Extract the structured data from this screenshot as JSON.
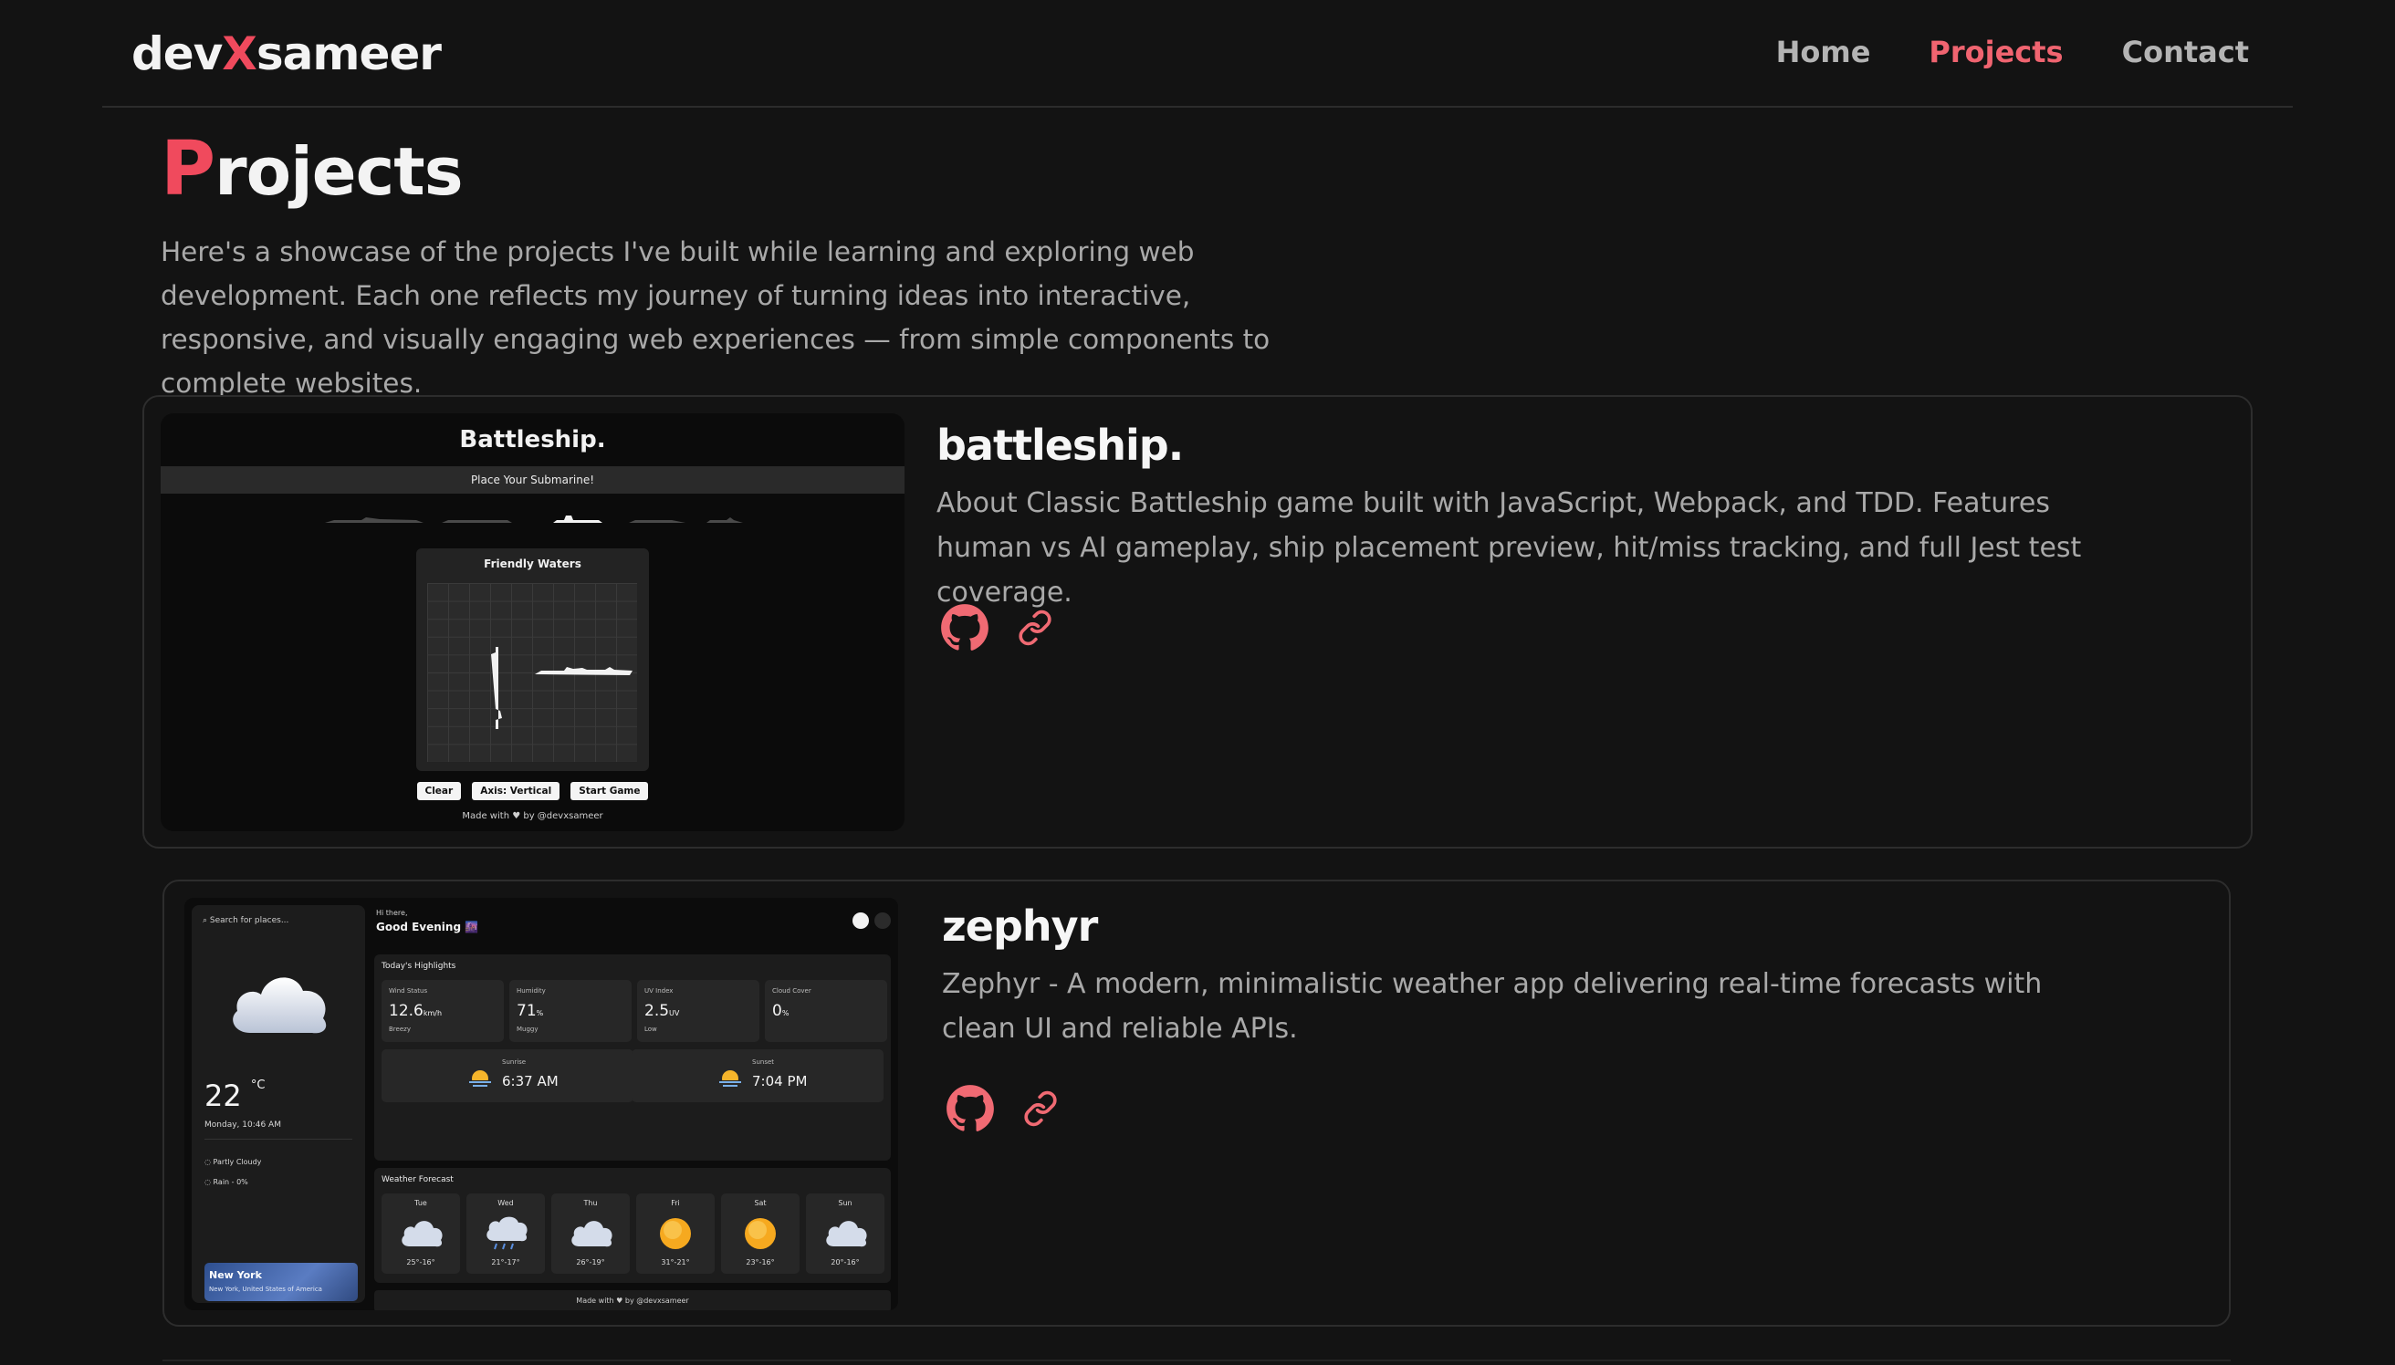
{
  "header": {
    "logo_prefix": "dev",
    "logo_x": "X",
    "logo_suffix": "sameer",
    "nav": [
      {
        "label": "Home"
      },
      {
        "label": "Projects"
      },
      {
        "label": "Contact"
      }
    ]
  },
  "intro": {
    "title_first": "P",
    "title_rest": "rojects",
    "text": "Here's a showcase of the projects I've built while learning and exploring web development. Each one reflects my journey of turning ideas into interactive, responsive, and visually engaging web experiences — from simple components to complete websites."
  },
  "projects": [
    {
      "title": "battleship.",
      "description": "About Classic Battleship game built with JavaScript, Webpack, and TDD. Features human vs AI gameplay, ship placement preview, hit/miss tracking, and full Jest test coverage.",
      "preview": {
        "title": "Battleship.",
        "banner": "Place Your Submarine!",
        "board_title": "Friendly Waters",
        "buttons": [
          "Clear",
          "Axis: Vertical",
          "Start Game"
        ],
        "footer": "Made with ♥ by @devxsameer"
      }
    },
    {
      "title": "zephyr",
      "description": "Zephyr - A modern, minimalistic weather app delivering real-time forecasts with clean UI and reliable APIs.",
      "preview": {
        "search_placeholder": "Search for places...",
        "temperature": "22",
        "unit": "°C",
        "date": "Monday, 10:46 AM",
        "condition": "Partly Cloudy",
        "rain": "Rain - 0%",
        "city": "New York",
        "country": "New York, United States of America",
        "greeting_small": "Hi there,",
        "greeting": "Good Evening 🌆",
        "highlights_title": "Today's Highlights",
        "highlights": [
          {
            "label": "Wind Status",
            "value": "12.6",
            "unit": "km/h",
            "sub": "Breezy"
          },
          {
            "label": "Humidity",
            "value": "71",
            "unit": "%",
            "sub": "Muggy"
          },
          {
            "label": "UV Index",
            "value": "2.5",
            "unit": "UV",
            "sub": "Low"
          },
          {
            "label": "Cloud Cover",
            "value": "0",
            "unit": "%",
            "sub": ""
          }
        ],
        "sunrise_label": "Sunrise",
        "sunrise": "6:37 AM",
        "sunset_label": "Sunset",
        "sunset": "7:04 PM",
        "forecast_title": "Weather Forecast",
        "forecast": [
          {
            "day": "Tue",
            "temps": "25°-16°",
            "icon": "cloud"
          },
          {
            "day": "Wed",
            "temps": "21°-17°",
            "icon": "rain"
          },
          {
            "day": "Thu",
            "temps": "26°-19°",
            "icon": "cloud"
          },
          {
            "day": "Fri",
            "temps": "31°-21°",
            "icon": "sun"
          },
          {
            "day": "Sat",
            "temps": "23°-16°",
            "icon": "sun"
          },
          {
            "day": "Sun",
            "temps": "20°-16°",
            "icon": "cloud"
          }
        ],
        "footer": "Made with ♥ by @devxsameer"
      }
    }
  ],
  "colors": {
    "accent": "#f04a5d",
    "nav_active": "#f06470",
    "background": "#131313",
    "icon": "#f06a73"
  }
}
